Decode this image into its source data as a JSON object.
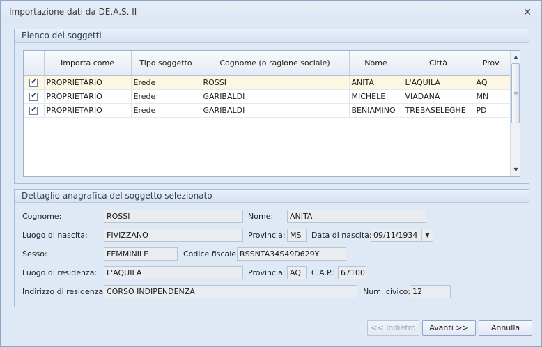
{
  "window": {
    "title": "Importazione dati da DE.A.S. II"
  },
  "subjects": {
    "group_title": "Elenco dei soggetti",
    "columns": [
      "Importa come",
      "Tipo soggetto",
      "Cognome (o ragione sociale)",
      "Nome",
      "Città",
      "Prov."
    ],
    "rows": [
      {
        "checked": true,
        "importa": "PROPRIETARIO",
        "tipo": "Erede",
        "cognome": "ROSSI",
        "nome": "ANITA",
        "citta": "L'AQUILA",
        "prov": "AQ"
      },
      {
        "checked": true,
        "importa": "PROPRIETARIO",
        "tipo": "Erede",
        "cognome": "GARIBALDI",
        "nome": "MICHELE",
        "citta": "VIADANA",
        "prov": "MN"
      },
      {
        "checked": true,
        "importa": "PROPRIETARIO",
        "tipo": "Erede",
        "cognome": "GARIBALDI",
        "nome": "BENIAMINO",
        "citta": "TREBASELEGHE",
        "prov": "PD"
      }
    ]
  },
  "detail": {
    "group_title": "Dettaglio anagrafica del soggetto selezionato",
    "cognome_label": "Cognome:",
    "cognome": "ROSSI",
    "nome_label": "Nome:",
    "nome": "ANITA",
    "luogo_nascita_label": "Luogo di nascita:",
    "luogo_nascita": "FIVIZZANO",
    "provincia_label": "Provincia:",
    "provincia_nascita": "MS",
    "data_nascita_label": "Data di nascita:",
    "data_nascita": "09/11/1934",
    "sesso_label": "Sesso:",
    "sesso": "FEMMINILE",
    "codice_fiscale_label": "Codice fiscale:",
    "codice_fiscale": "RSSNTA34S49D629Y",
    "luogo_residenza_label": "Luogo di residenza:",
    "luogo_residenza": "L'AQUILA",
    "provincia_residenza_label": "Provincia:",
    "provincia_residenza": "AQ",
    "cap_label": "C.A.P.:",
    "cap": "67100",
    "indirizzo_label": "Indirizzo di residenza:",
    "indirizzo": "CORSO INDIPENDENZA",
    "civico_label": "Num. civico:",
    "civico": "12"
  },
  "buttons": {
    "back": "<< Indietro",
    "next": "Avanti >>",
    "cancel": "Annulla"
  }
}
